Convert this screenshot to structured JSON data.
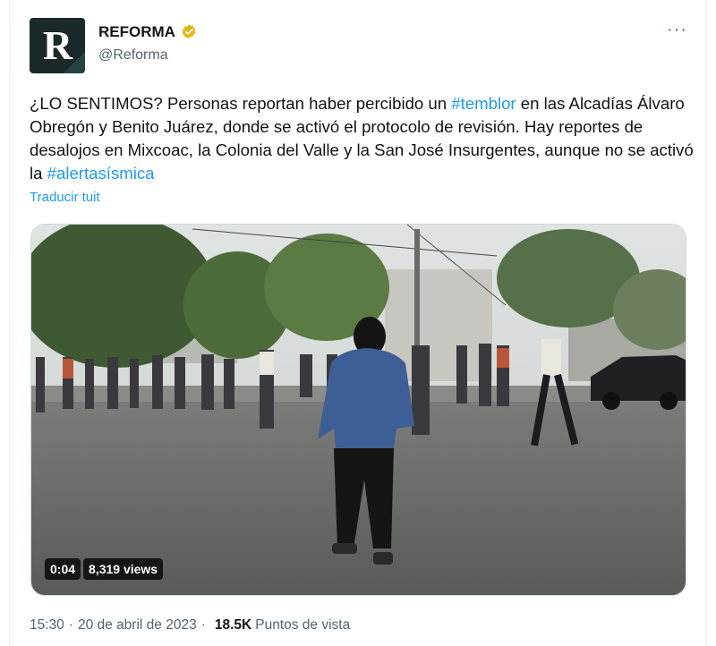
{
  "tweet": {
    "avatar_letter": "R",
    "author_name": "REFORMA",
    "handle": "@Reforma",
    "more_label": "···",
    "text_parts": {
      "p1": "¿LO SENTIMOS? Personas reportan haber percibido un ",
      "h1": "#temblor",
      "p2": " en las Alcadías Álvaro Obregón y Benito Juárez, donde se activó el protocolo de revisión. Hay reportes de desalojos en Mixcoac, la Colonia del Valle y la San José Insurgentes, aunque no se activó la ",
      "h2": "#alertasísmica"
    },
    "translate_label": "Traducir tuit",
    "video": {
      "duration": "0:04",
      "views": "8,319 views"
    },
    "time": "15:30",
    "date_separator": "·",
    "date": "20 de abril de 2023",
    "views_separator": "·",
    "views_count": "18.5K",
    "views_label": "Puntos de vista"
  },
  "colors": {
    "accent": "#1d9bf0",
    "verified_gold": "#e2b719",
    "text": "#0f1419",
    "muted": "#536471"
  }
}
